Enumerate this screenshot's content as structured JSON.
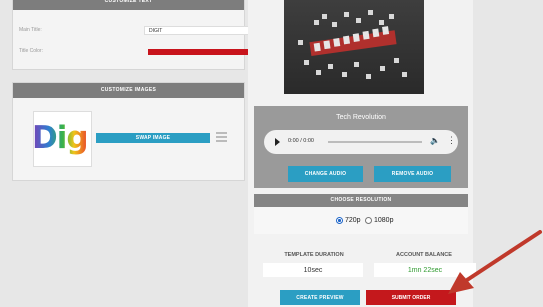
{
  "left_top": {
    "header": "CUSTOMIZE TEXT",
    "main_title_label": "Main Title:",
    "main_title_value": "DIGIT",
    "title_color_label": "Title Color:",
    "title_color_value": "#c8141c"
  },
  "images": {
    "header": "CUSTOMIZE IMAGES",
    "thumb_text": "Dig",
    "swap_label": "SWAP IMAGE"
  },
  "audio": {
    "title": "Tech Revolution",
    "time": "0:00 / 0:00",
    "change_label": "CHANGE AUDIO",
    "remove_label": "REMOVE AUDIO"
  },
  "resolution": {
    "header": "CHOOSE RESOLUTION",
    "options": [
      "720p",
      "1080p"
    ],
    "selected": "720p"
  },
  "stats": {
    "duration_label": "TEMPLATE DURATION",
    "duration_value": "10sec",
    "balance_label": "ACCOUNT BALANCE",
    "balance_value": "1mn 22sec"
  },
  "actions": {
    "preview_label": "CREATE PREVIEW",
    "submit_label": "SUBMIT ORDER"
  },
  "colors": {
    "accent": "#2b9ec3",
    "submit": "#c4181c",
    "arrow": "#c0392b",
    "balance": "#2e9a2e"
  }
}
